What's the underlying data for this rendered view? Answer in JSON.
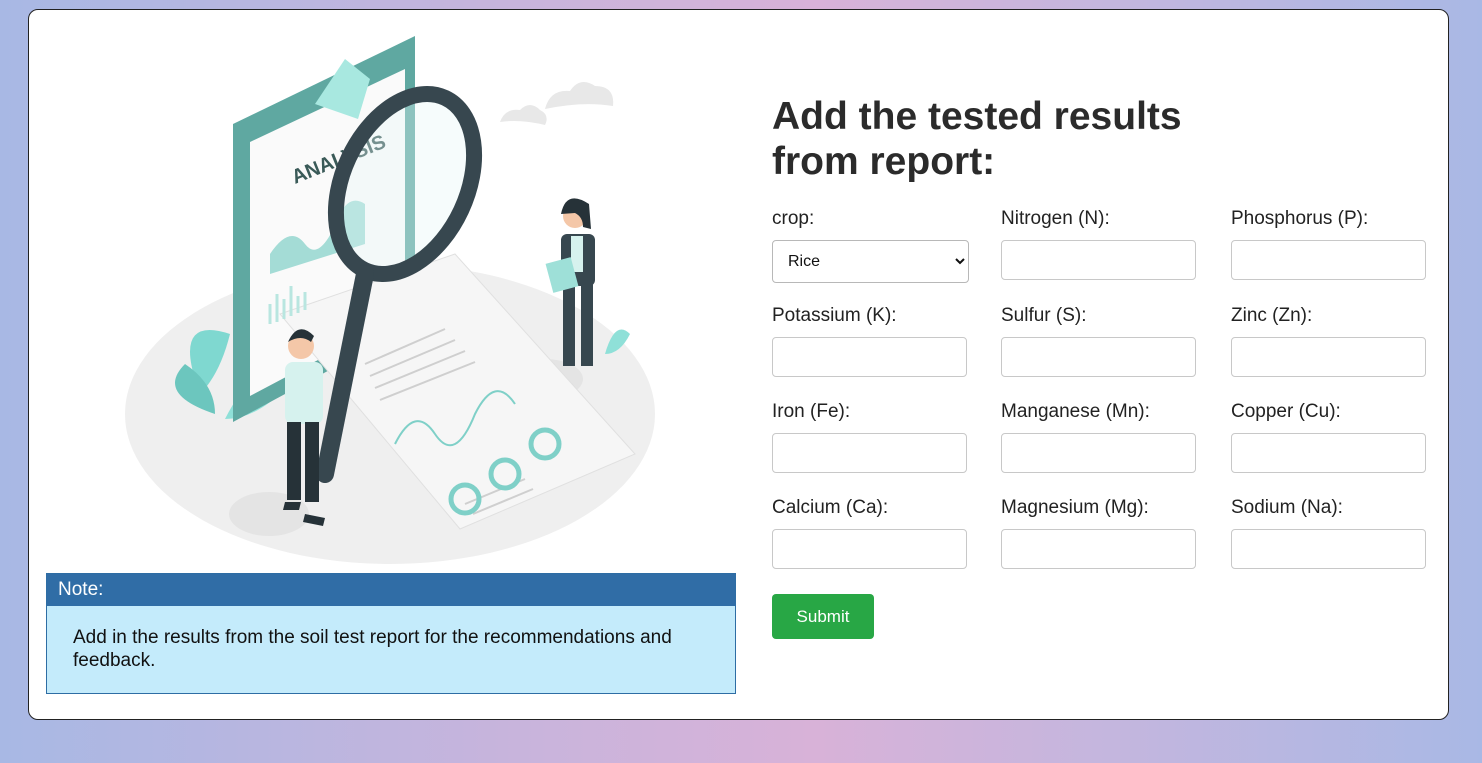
{
  "heading": "Add the tested results from report:",
  "illustration": {
    "clipboard_text": "ANALYSIS"
  },
  "note": {
    "title": "Note:",
    "text": "Add in the results from the soil test report for the recommendations and feedback."
  },
  "form": {
    "crop": {
      "label": "crop:",
      "selected": "Rice"
    },
    "nitrogen": {
      "label": "Nitrogen (N):",
      "value": ""
    },
    "phosphorus": {
      "label": "Phosphorus (P):",
      "value": ""
    },
    "potassium": {
      "label": "Potassium (K):",
      "value": ""
    },
    "sulfur": {
      "label": "Sulfur (S):",
      "value": ""
    },
    "zinc": {
      "label": "Zinc (Zn):",
      "value": ""
    },
    "iron": {
      "label": "Iron (Fe):",
      "value": ""
    },
    "manganese": {
      "label": "Manganese (Mn):",
      "value": ""
    },
    "copper": {
      "label": "Copper (Cu):",
      "value": ""
    },
    "calcium": {
      "label": "Calcium (Ca):",
      "value": ""
    },
    "magnesium": {
      "label": "Magnesium (Mg):",
      "value": ""
    },
    "sodium": {
      "label": "Sodium (Na):",
      "value": ""
    },
    "submit_label": "Submit"
  },
  "colors": {
    "note_header": "#306da6",
    "note_body": "#c4ebfb",
    "submit": "#28a745",
    "illustration_teal": "#5fa8a1"
  }
}
